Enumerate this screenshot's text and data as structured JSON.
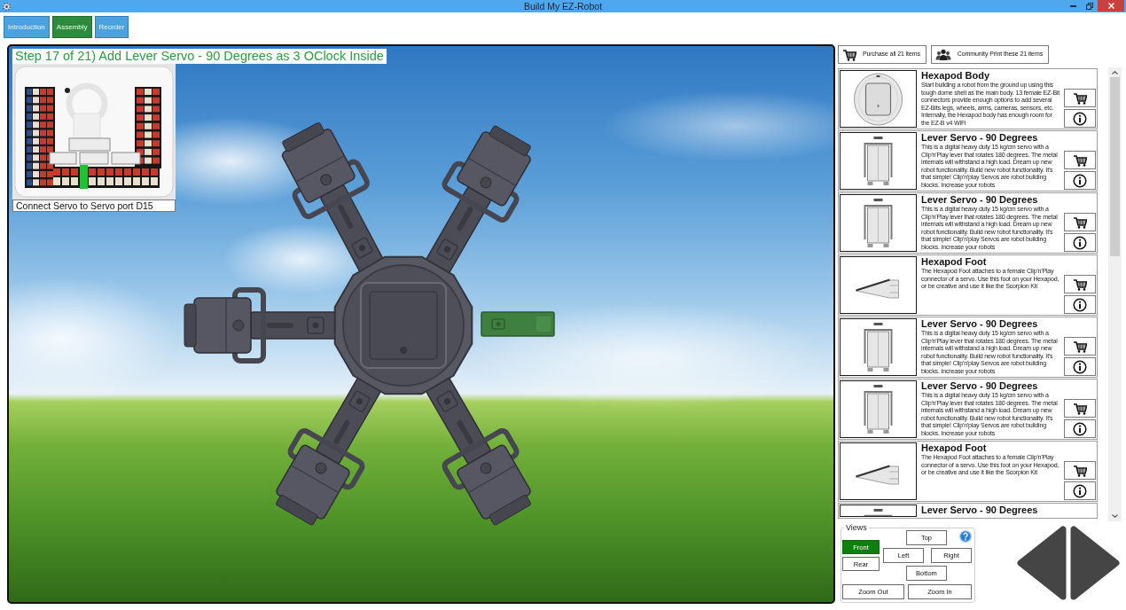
{
  "window": {
    "title": "Build My EZ-Robot"
  },
  "tabs": [
    {
      "label": "Introduction",
      "selected": false
    },
    {
      "label": "Assembly",
      "selected": true
    },
    {
      "label": "Reorder",
      "selected": false
    }
  ],
  "scene": {
    "step_title": "Step 17 of 21) Add Lever Servo - 90 Degrees as 3 OClock Inside",
    "port_caption": "Connect Servo to Servo port D15"
  },
  "actions": [
    {
      "kind": "cart",
      "label": "Purchase all 21 items"
    },
    {
      "kind": "community",
      "label": "Community Print these 21 items"
    }
  ],
  "parts": [
    {
      "kind": "body",
      "title": "Hexapod Body",
      "description": "Start building a robot from the ground up using this tough dome shell as the main body. 13 female EZ-Bit connectors provide enough options to add several EZ-Bits legs, wheels, arms, cameras, sensors, etc. Internally, the Hexapod body has enough room for the EZ-B v4 WiFi"
    },
    {
      "kind": "servo",
      "title": "Lever Servo - 90 Degrees",
      "description": "This is a digital heavy duty 15 kg/cm servo with a Clip'n'Play lever that rotates 180 degrees. The metal internals will withstand a high load. Dream up new robot functionality. Build new robot functionality. It's that simple! Clip'n'play Servos are robot building blocks. Increase your robots"
    },
    {
      "kind": "servo",
      "title": "Lever Servo - 90 Degrees",
      "description": "This is a digital heavy duty 15 kg/cm servo with a Clip'n'Play lever that rotates 180 degrees. The metal internals will withstand a high load. Dream up new robot functionality. Build new robot functionality. It's that simple! Clip'n'play Servos are robot building blocks. Increase your robots"
    },
    {
      "kind": "foot",
      "title": "Hexapod Foot",
      "description": "The Hexapod Foot attaches to a female Clip'n'Play connector of a servo. Use this foot on your Hexapod, or be creative and use it like the Scorpion Kit"
    },
    {
      "kind": "servo",
      "title": "Lever Servo - 90 Degrees",
      "description": "This is a digital heavy duty 15 kg/cm servo with a Clip'n'Play lever that rotates 180 degrees. The metal internals will withstand a high load. Dream up new robot functionality. Build new robot functionality. It's that simple! Clip'n'play Servos are robot building blocks. Increase your robots"
    },
    {
      "kind": "servo",
      "title": "Lever Servo - 90 Degrees",
      "description": "This is a digital heavy duty 15 kg/cm servo with a Clip'n'Play lever that rotates 180 degrees. The metal internals will withstand a high load. Dream up new robot functionality. Build new robot functionality. It's that simple! Clip'n'play Servos are robot building blocks. Increase your robots"
    },
    {
      "kind": "foot",
      "title": "Hexapod Foot",
      "description": "The Hexapod Foot attaches to a female Clip'n'Play connector of a servo. Use this foot on your Hexapod, or be creative and use it like the Scorpion Kit"
    },
    {
      "kind": "servo",
      "title": "Lever Servo - 90 Degrees"
    }
  ],
  "views": {
    "title": "Views",
    "buttons": [
      {
        "label": "Top",
        "selected": false
      },
      {
        "label": "Front",
        "selected": true
      },
      {
        "label": "Rear",
        "selected": false
      },
      {
        "label": "Left",
        "selected": false
      },
      {
        "label": "Right",
        "selected": false
      },
      {
        "label": "Bottom",
        "selected": false
      }
    ],
    "zoom": [
      "Zoom Out",
      "Zoom In"
    ]
  }
}
